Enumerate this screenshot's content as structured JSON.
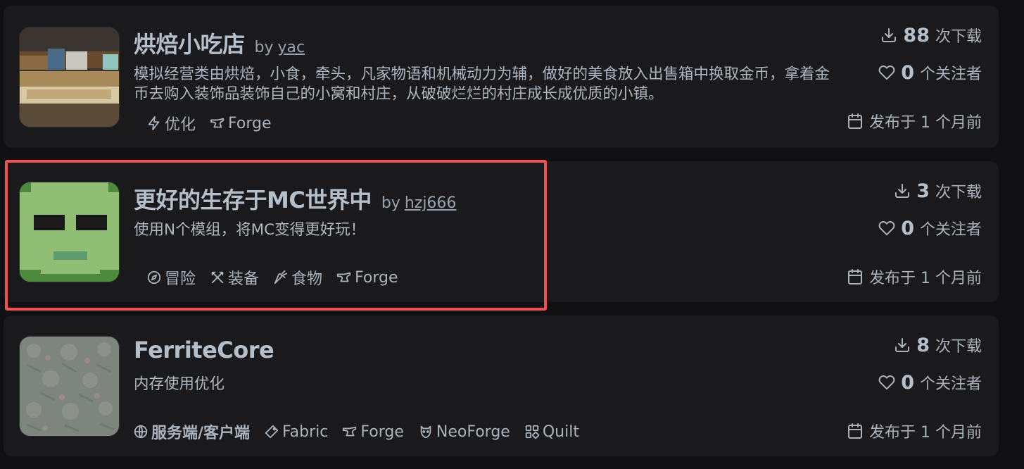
{
  "projects": [
    {
      "title": "烘焙小吃店",
      "by": "by",
      "author": "yac",
      "description": "模拟经营类由烘焙，小食，牵头，凡家物语和机械动力为辅，做好的美食放入出售箱中换取金币，拿着金币去购入装饰品装饰自己的小窝和村庄，从破破烂烂的村庄成长成优质的小镇。",
      "tags": [
        "优化",
        "Forge"
      ],
      "downloads": "88",
      "downloads_label": "次下载",
      "followers": "0",
      "followers_label": "个关注者",
      "published": "发布于 1 个月前"
    },
    {
      "title": "更好的生存于MC世界中",
      "by": "by",
      "author": "hzj666",
      "description": "使用N个模组，将MC变得更好玩！",
      "tags": [
        "冒险",
        "装备",
        "食物",
        "Forge"
      ],
      "downloads": "3",
      "downloads_label": "次下载",
      "followers": "0",
      "followers_label": "个关注者",
      "published": "发布于 1 个月前"
    },
    {
      "title": "FerriteCore",
      "description": "内存使用优化",
      "tags": [
        "服务端/客户端",
        "Fabric",
        "Forge",
        "NeoForge",
        "Quilt"
      ],
      "downloads": "8",
      "downloads_label": "次下载",
      "followers": "0",
      "followers_label": "个关注者",
      "published": "发布于 1 个月前"
    }
  ],
  "colors": {
    "background": "#111113",
    "card": "#1a1a1c",
    "highlight": "#ef5053"
  }
}
